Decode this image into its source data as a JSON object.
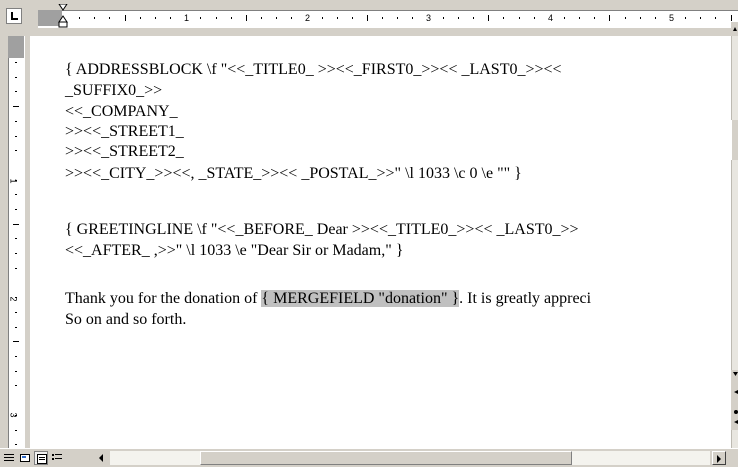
{
  "ruler": {
    "unit_numbers": [
      "1",
      "2",
      "3",
      "4",
      "5"
    ],
    "vertical_numbers": [
      "1",
      "2",
      "3"
    ]
  },
  "document": {
    "lines": [
      "{ ADDRESSBLOCK \\f \"<<_TITLE0_ >><<_FIRST0_>><< _LAST0_>><<",
      "_SUFFIX0_>>",
      "<<_COMPANY_",
      ">><<_STREET1_",
      ">><<_STREET2_",
      ">><<_CITY_>><<, _STATE_>><< _POSTAL_>>\" \\l 1033 \\c 0 \\e \"\" }",
      "{ GREETINGLINE \\f \"<<_BEFORE_ Dear >><<_TITLE0_>><< _LAST0_>>",
      "<<_AFTER_ ,>>\" \\l 1033 \\e \"Dear Sir or Madam,\" }"
    ],
    "body_line_prefix": "Thank you for the donation of ",
    "field_code": "{ MERGEFIELD \"donation\" }",
    "body_line_suffix": ".  It is greatly appreci",
    "last_line": "So on and so forth."
  },
  "icons": {
    "tab_selector": "left-tab-icon",
    "normal_view": "normal-view-icon",
    "web_view": "web-layout-view-icon",
    "print_view": "print-layout-view-icon",
    "outline_view": "outline-view-icon",
    "scroll_left": "scroll-left-arrow-icon",
    "scroll_right": "scroll-right-arrow-icon"
  },
  "colors": {
    "chrome": "#d4d0c8",
    "field_shading": "#c0c0c0",
    "page": "#ffffff"
  }
}
